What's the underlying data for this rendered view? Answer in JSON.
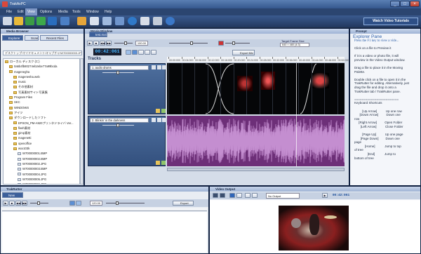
{
  "window": {
    "title": "TrakAxPC"
  },
  "menu": [
    "File",
    "Edit",
    "View",
    "Options",
    "Media",
    "Tools",
    "Window",
    "Help"
  ],
  "toolbar": {
    "video_tutorials": "Watch Video Tutorials"
  },
  "media_browser": {
    "title": "Media Browser",
    "tabs": [
      "Explorer",
      "Scan",
      "Recent Files"
    ],
    "path": "デスクトップ\\マイドキュメント\\キャプチャ\\W700000003.JPG",
    "tree": [
      {
        "label": "ローカル ディスク (C:)",
        "indent": 0,
        "type": "folder"
      },
      {
        "label": "0a5b4fb80274eb2ebe77a99bcda",
        "indent": 1,
        "type": "folder"
      },
      {
        "label": "magenegha",
        "indent": 1,
        "type": "folder"
      },
      {
        "label": "magenesha.web",
        "indent": 2,
        "type": "folder"
      },
      {
        "label": "music",
        "indent": 2,
        "type": "folder"
      },
      {
        "label": "その他素材",
        "indent": 2,
        "type": "folder"
      },
      {
        "label": "写真素材サイト写真集",
        "indent": 2,
        "type": "folder"
      },
      {
        "label": "Program Files",
        "indent": 1,
        "type": "folder"
      },
      {
        "label": "SKC",
        "indent": 1,
        "type": "folder"
      },
      {
        "label": "WINDOWS",
        "indent": 1,
        "type": "folder"
      },
      {
        "label": "アイツ",
        "indent": 1,
        "type": "folder"
      },
      {
        "label": "ダウンロードしたソフト",
        "indent": 1,
        "type": "folder"
      },
      {
        "label": "EPSON_PM-A920プリンタドライバ Ver...",
        "indent": 2,
        "type": "folder"
      },
      {
        "label": "flash素材",
        "indent": 2,
        "type": "folder"
      },
      {
        "label": "gimp素材",
        "indent": 2,
        "type": "folder"
      },
      {
        "label": "magenetti",
        "indent": 2,
        "type": "folder"
      },
      {
        "label": "openoffice",
        "indent": 2,
        "type": "folder"
      },
      {
        "label": "wxx103k",
        "indent": 2,
        "type": "folder"
      },
      {
        "label": "W700000001.BMP",
        "indent": 3,
        "type": "file"
      },
      {
        "label": "W700000002.BMP",
        "indent": 3,
        "type": "file"
      },
      {
        "label": "W700000002.JPG",
        "indent": 3,
        "type": "file"
      },
      {
        "label": "W700000003.BMP",
        "indent": 3,
        "type": "file"
      },
      {
        "label": "W700000004.JPG",
        "indent": 3,
        "type": "file"
      },
      {
        "label": "W700000005.JPG",
        "indent": 3,
        "type": "file"
      },
      {
        "label": "W700000006.JPG",
        "indent": 3,
        "type": "file"
      },
      {
        "label": "W700000003.JPG",
        "indent": 3,
        "type": "file",
        "selected": true
      }
    ]
  },
  "movie_window": {
    "title": "Movie Window",
    "tab": "test.mxt",
    "zoom": "100.00",
    "timecode": "00:42:061",
    "export_label": "Export Mix",
    "target_frame_size_label": "Target Frame Size",
    "target_frame_size": "640 × 480  (4:3)",
    "tracks_label": "Tracks",
    "ruler": [
      "00:00:000",
      "00:04:000",
      "00:08:000",
      "00:12:000",
      "00:16:000",
      "00:20:000",
      "00:24:000",
      "00:28:000",
      "00:32:000",
      "00:36:000",
      "00:40:000",
      "00:44:000",
      "00:48:000",
      "00:52:000"
    ],
    "tracks": [
      {
        "name": "1. audio drums"
      },
      {
        "name": "2. Blinkin' in the darkness"
      }
    ]
  },
  "prompt": {
    "title": "Prompt",
    "heading": "Explorer Pane",
    "subheading": "Press the F1 key to view a vide...",
    "body": "Click on a file to Preview it\n\nIf it is a video or photo file, it will\npreview in the Video Output window.\n\nDrag a file to place it in the Moving\nPalette.\n\nDouble click on a file to open it in the\nTrakRutter for editing. Alternatively, just\ndrag the file and drop it onto a\nTrakRutter tab / TrakRutter pane.\n\n========================\nKeyboard Shortcuts\n\n         [Up Arrow]          Up one row\n      [Down Arrow]         Down one\nrow\n     [Right Arrow]         Open Folder\n       [Left Arrow]          Close Folder\n\n         [Page Up]          Up one page\n       [Page Down]        Down one\npage\n            [Home]           Jump to top\nof tree\n               [End]           Jump to\nbottom of tree"
  },
  "trakrutter": {
    "title": "TrakRutter",
    "tab": "New Tab",
    "zoom": "120.00",
    "export_label": "Export"
  },
  "video_output": {
    "title": "Video Output",
    "source": "No Output",
    "timecode": "00:42:061"
  }
}
